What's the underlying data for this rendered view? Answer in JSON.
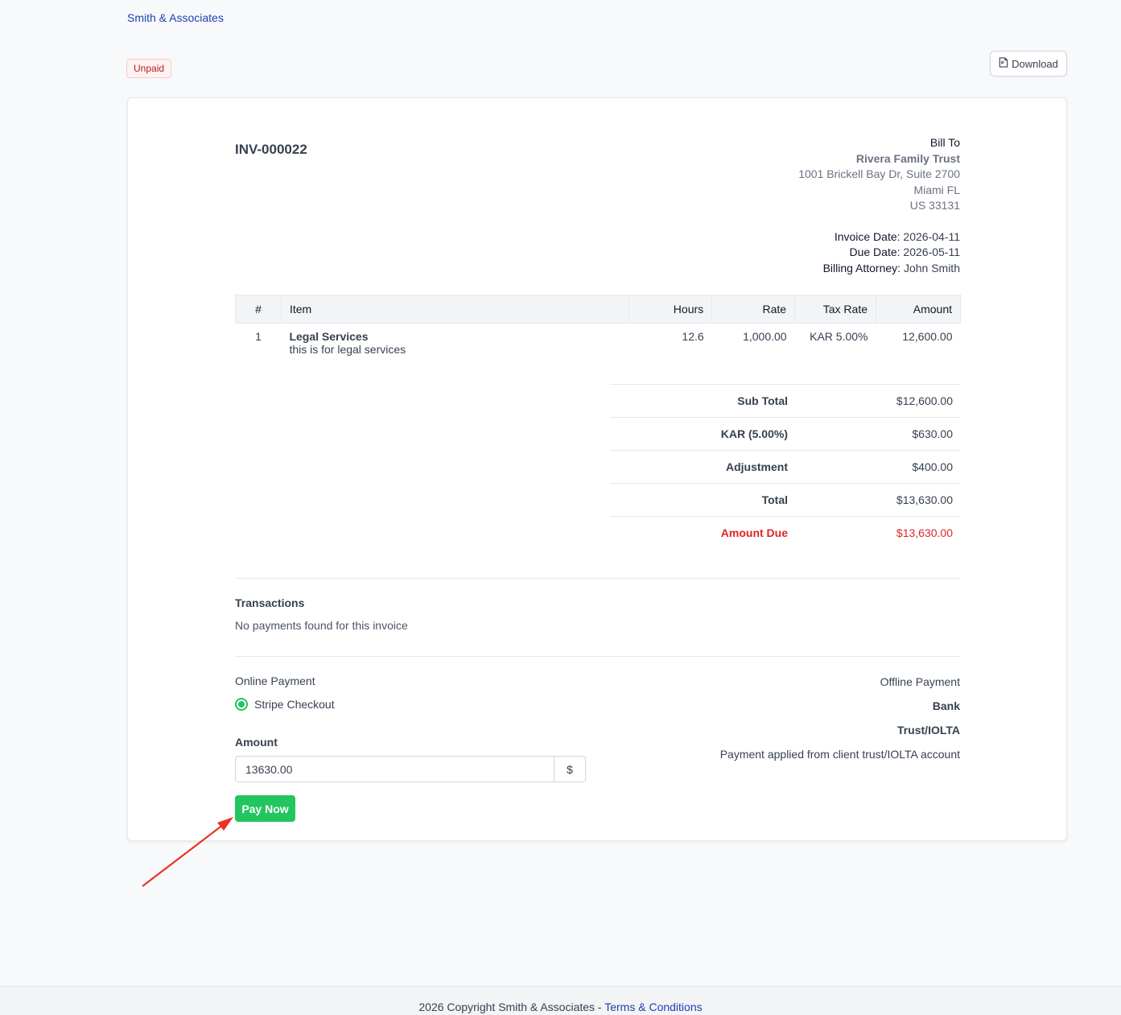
{
  "header": {
    "firm_name": "Smith & Associates",
    "status": "Unpaid",
    "download_label": "Download"
  },
  "invoice": {
    "number": "INV-000022",
    "bill_to_label": "Bill To",
    "client_name": "Rivera Family Trust",
    "address_line1": "1001 Brickell Bay Dr, Suite 2700",
    "address_line2": "Miami FL",
    "address_line3": "US 33131",
    "invoice_date_label": "Invoice Date:",
    "invoice_date": "2026-04-11",
    "due_date_label": "Due Date:",
    "due_date": "2026-05-11",
    "attorney_label": "Billing Attorney:",
    "attorney": "John Smith"
  },
  "table": {
    "columns": [
      "#",
      "Item",
      "Hours",
      "Rate",
      "Tax Rate",
      "Amount"
    ],
    "rows": [
      {
        "num": "1",
        "item": "Legal Services",
        "description": "this is for legal services",
        "hours": "12.6",
        "rate": "1,000.00",
        "tax_rate": "KAR 5.00%",
        "amount": "12,600.00"
      }
    ]
  },
  "totals": {
    "sub_total_label": "Sub Total",
    "sub_total": "$12,600.00",
    "tax_label": "KAR (5.00%)",
    "tax": "$630.00",
    "adjustment_label": "Adjustment",
    "adjustment": "$400.00",
    "total_label": "Total",
    "total": "$13,630.00",
    "amount_due_label": "Amount Due",
    "amount_due": "$13,630.00"
  },
  "transactions": {
    "title": "Transactions",
    "empty_message": "No payments found for this invoice"
  },
  "online_payment": {
    "title": "Online Payment",
    "method": "Stripe Checkout",
    "amount_label": "Amount",
    "amount_value": "13630.00",
    "currency_symbol": "$",
    "pay_label": "Pay Now"
  },
  "offline_payment": {
    "title": "Offline Payment",
    "bank_label": "Bank",
    "trust_label": "Trust/IOLTA",
    "trust_description": "Payment applied from client trust/IOLTA account"
  },
  "footer": {
    "copyright": "2026 Copyright Smith & Associates - ",
    "terms_label": "Terms & Conditions"
  },
  "colors": {
    "accent_green": "#22c55e",
    "due_red": "#dc2626",
    "link_blue": "#1e40af",
    "annotation_arrow": "#ea3323"
  }
}
